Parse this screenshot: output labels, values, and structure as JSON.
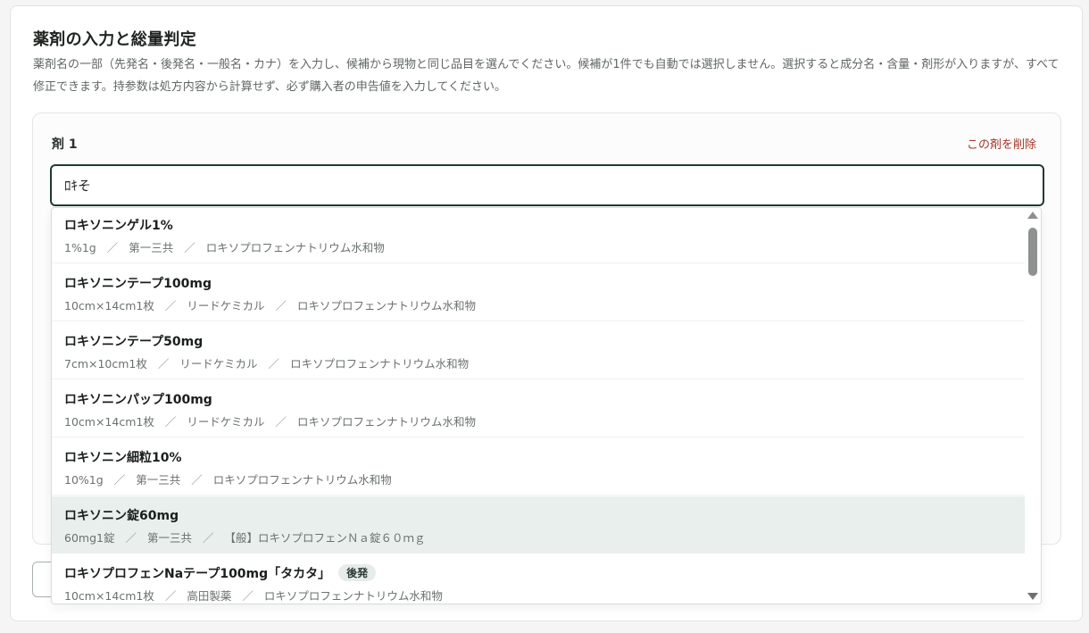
{
  "section": {
    "title": "薬剤の入力と総量判定",
    "description": "薬剤名の一部（先発名・後発名・一般名・カナ）を入力し、候補から現物と同じ品目を選んでください。候補が1件でも自動では選択しません。選択すると成分名・含量・剤形が入りますが、すべて修正できます。持参数は処方内容から計算せず、必ず購入者の申告値を入力してください。"
  },
  "drug": {
    "label": "剤 1",
    "delete_label": "この剤を削除",
    "search_value": "ﾛｷそ"
  },
  "suggestions": [
    {
      "name": "ロキソニンゲル1%",
      "spec": "1%1g",
      "maker": "第一三共",
      "ingredient": "ロキソプロフェンナトリウム水和物",
      "badge": ""
    },
    {
      "name": "ロキソニンテープ100mg",
      "spec": "10cm×14cm1枚",
      "maker": "リードケミカル",
      "ingredient": "ロキソプロフェンナトリウム水和物",
      "badge": ""
    },
    {
      "name": "ロキソニンテープ50mg",
      "spec": "7cm×10cm1枚",
      "maker": "リードケミカル",
      "ingredient": "ロキソプロフェンナトリウム水和物",
      "badge": ""
    },
    {
      "name": "ロキソニンパップ100mg",
      "spec": "10cm×14cm1枚",
      "maker": "リードケミカル",
      "ingredient": "ロキソプロフェンナトリウム水和物",
      "badge": ""
    },
    {
      "name": "ロキソニン細粒10%",
      "spec": "10%1g",
      "maker": "第一三共",
      "ingredient": "ロキソプロフェンナトリウム水和物",
      "badge": ""
    },
    {
      "name": "ロキソニン錠60mg",
      "spec": "60mg1錠",
      "maker": "第一三共",
      "ingredient": "【般】ロキソプロフェンＮａ錠６０ｍｇ",
      "badge": ""
    },
    {
      "name": "ロキソプロフェンNaテープ100mg「タカタ」",
      "spec": "10cm×14cm1枚",
      "maker": "高田製薬",
      "ingredient": "ロキソプロフェンナトリウム水和物",
      "badge": "後発"
    }
  ],
  "separator": "／",
  "highlighted_index": 5,
  "colors": {
    "accent_border": "#1f3b30",
    "delete_link": "#a3362a",
    "highlight_row": "#e8efec"
  }
}
